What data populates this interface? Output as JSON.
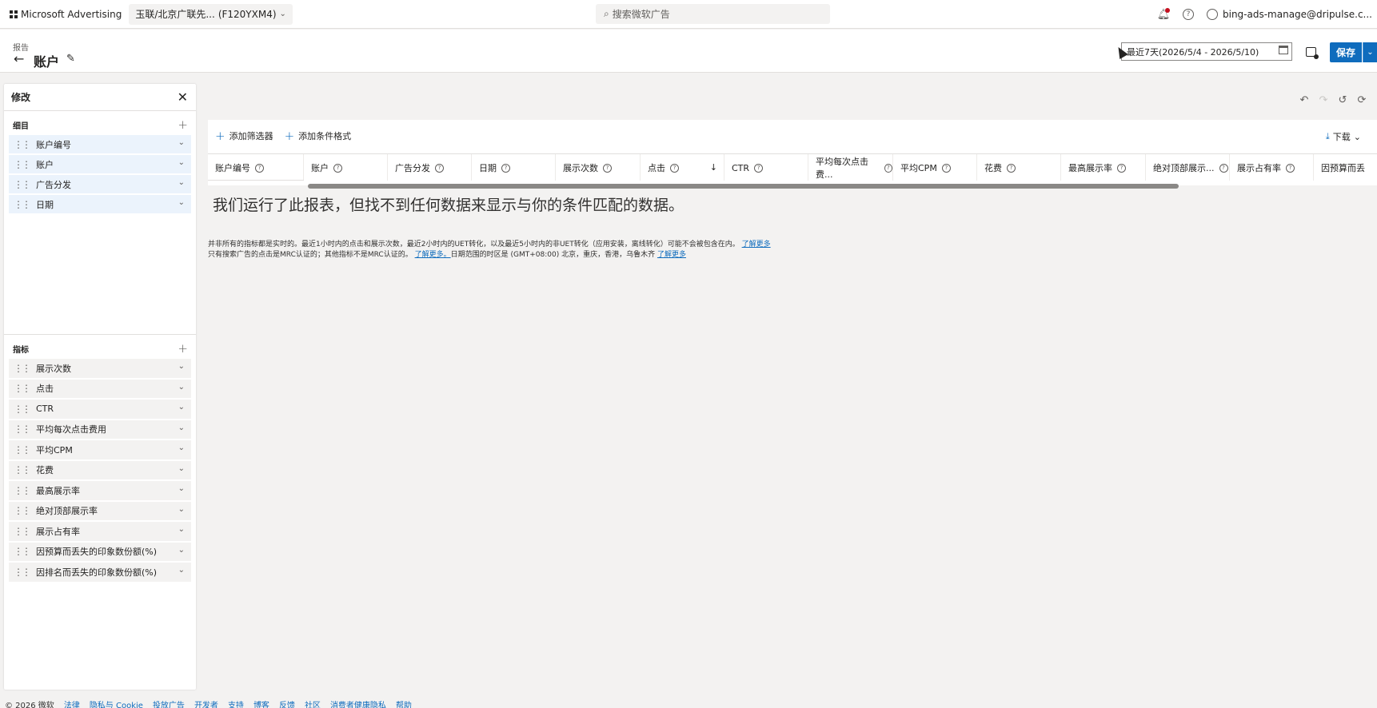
{
  "topbar": {
    "brand": "Microsoft Advertising",
    "account_name": "玉联/北京广联先...",
    "account_id": "(F120YXM4)",
    "search_placeholder": "搜索微软广告",
    "user": "bing-ads-manage@dripulse.c..."
  },
  "header": {
    "breadcrumb": "报告",
    "title": "账户",
    "date_range": "最近7天(2026/5/4 - 2026/5/10)",
    "save_label": "保存"
  },
  "panel": {
    "title": "修改",
    "dimensions_title": "细目",
    "dimensions": [
      {
        "label": "账户编号"
      },
      {
        "label": "账户"
      },
      {
        "label": "广告分发"
      },
      {
        "label": "日期"
      }
    ],
    "metrics_title": "指标",
    "metrics": [
      {
        "label": "展示次数"
      },
      {
        "label": "点击"
      },
      {
        "label": "CTR"
      },
      {
        "label": "平均每次点击费用"
      },
      {
        "label": "平均CPM"
      },
      {
        "label": "花费"
      },
      {
        "label": "最高展示率"
      },
      {
        "label": "绝对顶部展示率"
      },
      {
        "label": "展示占有率"
      },
      {
        "label": "因预算而丢失的印象数份额(%)"
      },
      {
        "label": "因排名而丢失的印象数份额(%)"
      }
    ]
  },
  "toolbar": {
    "add_filter": "添加筛选器",
    "add_conditional_format": "添加条件格式",
    "download": "下载"
  },
  "table": {
    "columns": [
      {
        "label": "账户编号",
        "help": true,
        "sort": ""
      },
      {
        "label": "账户",
        "help": true,
        "sort": ""
      },
      {
        "label": "广告分发",
        "help": true,
        "sort": ""
      },
      {
        "label": "日期",
        "help": true,
        "sort": ""
      },
      {
        "label": "展示次数",
        "help": true,
        "sort": ""
      },
      {
        "label": "点击",
        "help": true,
        "sort": "↓"
      },
      {
        "label": "CTR",
        "help": true,
        "sort": ""
      },
      {
        "label": "平均每次点击费...",
        "help": true,
        "sort": ""
      },
      {
        "label": "平均CPM",
        "help": true,
        "sort": ""
      },
      {
        "label": "花费",
        "help": true,
        "sort": ""
      },
      {
        "label": "最高展示率",
        "help": true,
        "sort": ""
      },
      {
        "label": "绝对顶部展示...",
        "help": true,
        "sort": ""
      },
      {
        "label": "展示占有率",
        "help": true,
        "sort": ""
      },
      {
        "label": "因预算而丢",
        "help": false,
        "sort": ""
      }
    ],
    "empty_message": "我们运行了此报表，但找不到任何数据来显示与你的条件匹配的数据。"
  },
  "notes": {
    "line1": "并非所有的指标都是实时的。最近1小时内的点击和展示次数，最近2小时内的UET转化，以及最近5小时内的非UET转化（应用安装，离线转化）可能不会被包含在内。",
    "line1_link": "了解更多",
    "line2": "只有搜索广告的点击是MRC认证的；其他指标不是MRC认证的。",
    "line2_link": "了解更多。",
    "line2_tail": "日期范围的时区是 (GMT+08:00) 北京，重庆，香港，乌鲁木齐",
    "line2_link2": "了解更多"
  },
  "footer": {
    "copyright": "© 2026 微软",
    "links": [
      "法律",
      "隐私与 Cookie",
      "投放广告",
      "开发者",
      "支持",
      "博客",
      "反馈",
      "社区",
      "消费者健康隐私",
      "帮助"
    ]
  },
  "colors": {
    "accent": "#0f6cbd",
    "dimension_bg": "#ebf3fc",
    "metric_bg": "#f3f2f1",
    "notification_dot": "#c50f1f"
  }
}
